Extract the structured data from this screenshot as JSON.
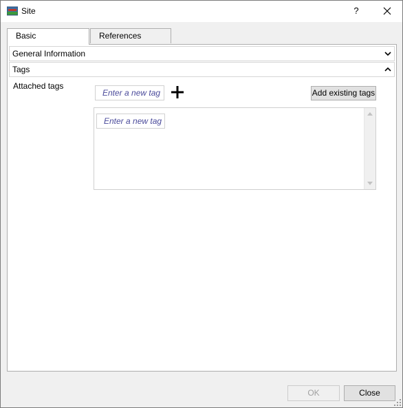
{
  "window": {
    "title": "Site",
    "help_label": "?",
    "icons": {
      "app": "site-app-icon",
      "close": "close-icon"
    }
  },
  "tabs": [
    {
      "label": "Basic",
      "active": true
    },
    {
      "label": "References",
      "active": false
    }
  ],
  "sections": {
    "general": {
      "label": "General Information",
      "state": "collapsed",
      "icon": "chevron-down-icon"
    },
    "tags": {
      "label": "Tags",
      "state": "expanded",
      "icon": "chevron-up-icon"
    }
  },
  "tags": {
    "attached_label": "Attached tags",
    "new_tag_placeholder": "Enter a new tag",
    "add_icon": "plus-icon",
    "add_existing_label": "Add existing tags",
    "list_placeholder": "Enter a new tag"
  },
  "footer": {
    "ok_label": "OK",
    "ok_enabled": false,
    "close_label": "Close"
  },
  "colors": {
    "placeholder_text": "#4b4b9b",
    "disabled_text": "#a0a0a0",
    "window_bg": "#f0f0f0"
  }
}
